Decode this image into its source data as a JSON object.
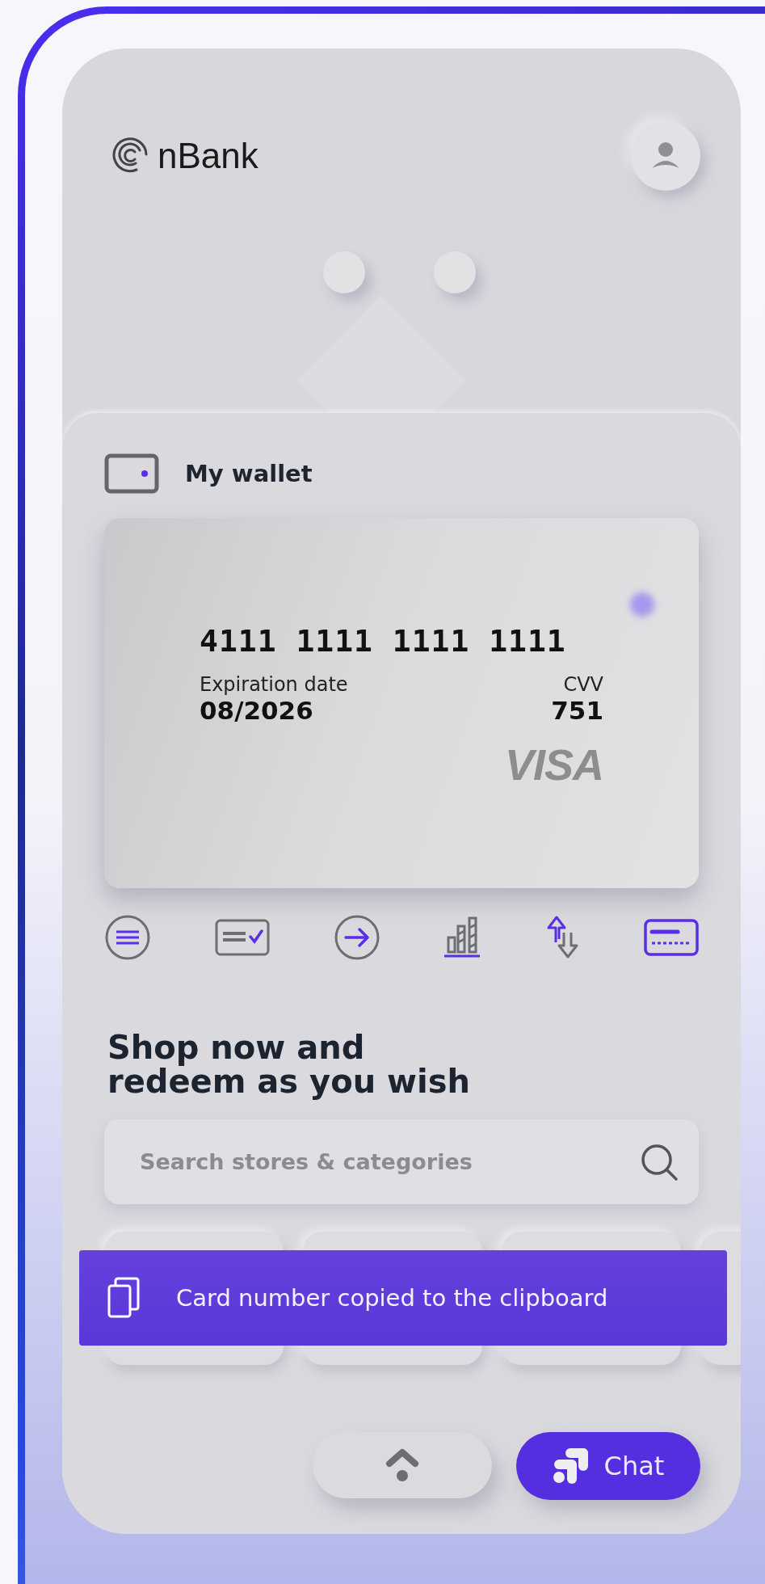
{
  "app": {
    "logo_text": "nBank"
  },
  "wallet": {
    "title": "My wallet",
    "card": {
      "number": "4111 1111 1111 1111",
      "expiration_label": "Expiration date",
      "expiration": "08/2026",
      "cvv_label": "CVV",
      "cvv": "751",
      "brand": "VISA"
    }
  },
  "card_actions": [
    {
      "kind": "menu",
      "selected": false
    },
    {
      "kind": "card-check",
      "selected": false
    },
    {
      "kind": "arrow",
      "selected": false
    },
    {
      "kind": "chart",
      "selected": false
    },
    {
      "kind": "transfer",
      "selected": false
    },
    {
      "kind": "card",
      "selected": true
    }
  ],
  "shop": {
    "title": "Shop now and\nredeem as you wish",
    "search": {
      "placeholder": "Search stores & categories"
    }
  },
  "toast": {
    "message": "Card number copied to the clipboard"
  },
  "bottom_bar": {
    "chat_label": "Chat"
  }
}
